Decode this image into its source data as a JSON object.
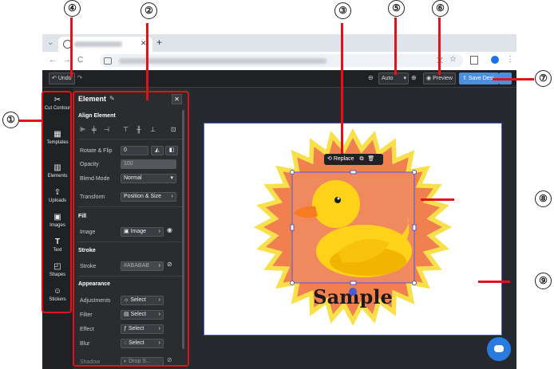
{
  "browser": {
    "tab_new": "+",
    "nav": {
      "back": "←",
      "forward": "→",
      "reload": "C"
    }
  },
  "toolbar": {
    "undo_label": "Undo",
    "zoom_value": "Auto",
    "preview_label": "Preview",
    "save_label": "Save Desi"
  },
  "rail": {
    "items": [
      {
        "label": "Cut Contour",
        "icon": "scissors-icon"
      },
      {
        "label": "Templates",
        "icon": "templates-icon"
      },
      {
        "label": "Elements",
        "icon": "elements-icon"
      },
      {
        "label": "Uploads",
        "icon": "upload-icon"
      },
      {
        "label": "Images",
        "icon": "image-icon"
      },
      {
        "label": "Text",
        "icon": "text-icon"
      },
      {
        "label": "Shapes",
        "icon": "shapes-icon"
      },
      {
        "label": "Stickers",
        "icon": "sticker-icon"
      }
    ]
  },
  "panel": {
    "title": "Element",
    "align_heading": "Align Element",
    "rotate_label": "Rotate & Flip",
    "rotate_value": "0",
    "opacity_label": "Opacity",
    "opacity_value": "100",
    "blend_label": "Blend Mode",
    "blend_value": "Normal",
    "transform_label": "Transform",
    "transform_value": "Position & Size",
    "fill_heading": "Fill",
    "image_label": "Image",
    "image_value": "Image",
    "stroke_heading": "Stroke",
    "stroke_label": "Stroke",
    "stroke_value": "#ABABAB",
    "appearance_heading": "Appearance",
    "adjustments_label": "Adjustments",
    "filter_label": "Filter",
    "effect_label": "Effect",
    "blur_label": "Blur",
    "shadow_label": "Shadow",
    "select_label": "Select",
    "shadow_value": "Drop S..."
  },
  "canvas": {
    "replace_label": "Replace",
    "sample_text": "Sample"
  },
  "colors": {
    "annotation_red": "#e4111a",
    "selection_blue": "#4b5bd6",
    "burst_orange": "#f08050",
    "burst_yellow": "#f7e04a",
    "duck_yellow": "#ffd21a",
    "beak_orange": "#f57c22"
  },
  "annotations": [
    "①",
    "②",
    "③",
    "④",
    "⑤",
    "⑥",
    "⑦",
    "⑧",
    "⑨"
  ]
}
